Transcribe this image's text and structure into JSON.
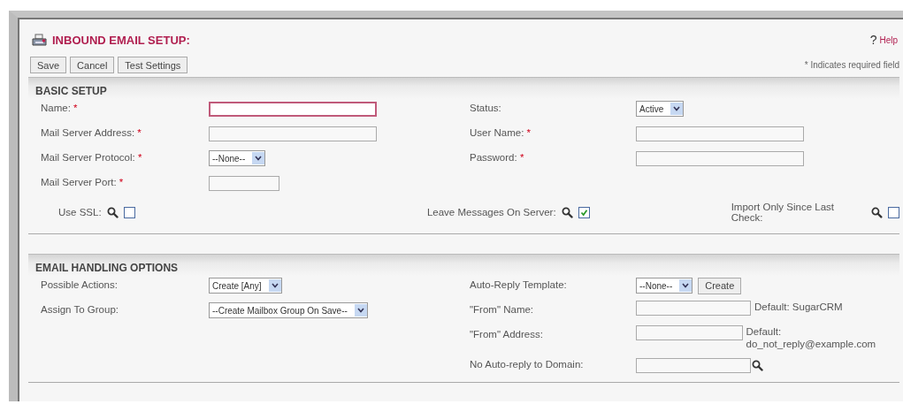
{
  "header": {
    "title": "INBOUND EMAIL SETUP:",
    "help_mark": "?",
    "help_link": "Help"
  },
  "buttons": [
    "Save",
    "Cancel",
    "Test Settings"
  ],
  "required_note": {
    "mark": "*",
    "text": "Indicates required field"
  },
  "basic_setup": {
    "title": "BASIC SETUP",
    "left": [
      {
        "label": "Name:",
        "required_mark": "*",
        "kind": "text",
        "focused": true
      },
      {
        "label": "Mail Server Address:",
        "required_mark": "*",
        "kind": "text",
        "focused": false
      },
      {
        "label": "Mail Server Protocol:",
        "required_mark": "*",
        "kind": "select",
        "value": "--None--"
      },
      {
        "label": "Mail Server Port:",
        "required_mark": "*",
        "kind": "short_text",
        "focused": false
      }
    ],
    "right": [
      {
        "label": "Status:",
        "kind": "select",
        "value": "Active"
      },
      {
        "label": "User Name:",
        "required_mark": "*",
        "kind": "text",
        "focused": false
      },
      {
        "label": "Password:",
        "required_mark": "*",
        "kind": "text",
        "focused": false
      }
    ],
    "options": [
      {
        "label": "Use SSL:",
        "checked": false
      },
      {
        "label": "Leave Messages On Server:",
        "checked": true
      },
      {
        "label": "Import Only Since Last Check:",
        "checked": false
      }
    ]
  },
  "email_handling": {
    "title": "EMAIL HANDLING OPTIONS",
    "left": [
      {
        "label": "Possible Actions:",
        "kind": "select",
        "value": "Create [Any]"
      },
      {
        "label": "Assign To Group:",
        "kind": "select",
        "value": "--Create Mailbox Group On Save--"
      }
    ],
    "right": [
      {
        "label": "Auto-Reply Template:",
        "kind": "select_button",
        "value": "--None--",
        "button": "Create"
      },
      {
        "label": "\"From\" Name:",
        "kind": "text_note",
        "note": "Default: SugarCRM",
        "focused": false
      },
      {
        "label": "\"From\" Address:",
        "kind": "text_note",
        "note": "Default: do_not_reply@example.com",
        "focused": false
      },
      {
        "label": "No Auto-reply to Domain:",
        "kind": "text_lookup",
        "focused": false
      }
    ]
  }
}
